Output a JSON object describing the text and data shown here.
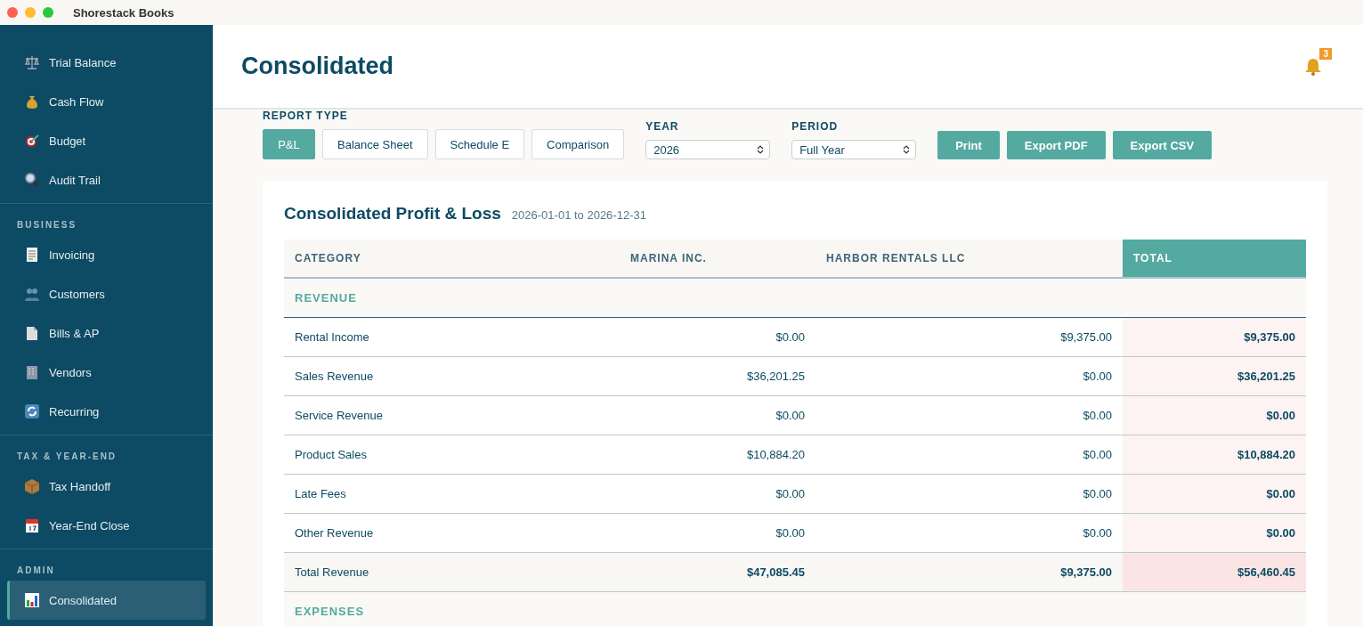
{
  "window": {
    "title": "Shorestack Books"
  },
  "sidebar": {
    "sections": [
      {
        "items": [
          {
            "label": "Trial Balance",
            "selected": false
          },
          {
            "label": "Cash Flow",
            "selected": false
          },
          {
            "label": "Budget",
            "selected": false
          },
          {
            "label": "Audit Trail",
            "selected": false
          }
        ]
      },
      {
        "label": "BUSINESS",
        "items": [
          {
            "label": "Invoicing",
            "selected": false
          },
          {
            "label": "Customers",
            "selected": false
          },
          {
            "label": "Bills & AP",
            "selected": false
          },
          {
            "label": "Vendors",
            "selected": false
          },
          {
            "label": "Recurring",
            "selected": false
          }
        ]
      },
      {
        "label": "TAX & YEAR-END",
        "items": [
          {
            "label": "Tax Handoff",
            "selected": false
          },
          {
            "label": "Year-End Close",
            "selected": false
          }
        ]
      },
      {
        "label": "ADMIN",
        "items": [
          {
            "label": "Consolidated",
            "selected": true
          }
        ]
      }
    ]
  },
  "header": {
    "title": "Consolidated",
    "notification_count": "3"
  },
  "controls": {
    "report_type": {
      "label": "REPORT TYPE",
      "options": [
        {
          "label": "P&L",
          "selected": true
        },
        {
          "label": "Balance Sheet",
          "selected": false
        },
        {
          "label": "Schedule E",
          "selected": false
        },
        {
          "label": "Comparison",
          "selected": false
        }
      ]
    },
    "year": {
      "label": "YEAR",
      "value": "2026"
    },
    "period": {
      "label": "PERIOD",
      "value": "Full Year"
    },
    "actions": [
      "Print",
      "Export PDF",
      "Export CSV"
    ]
  },
  "report": {
    "title": "Consolidated Profit & Loss",
    "date_range": "2026-01-01 to 2026-12-31",
    "columns": [
      {
        "label": "CATEGORY",
        "highlighted": false
      },
      {
        "label": "MARINA INC.",
        "highlighted": false
      },
      {
        "label": "HARBOR RENTALS LLC",
        "highlighted": false
      },
      {
        "label": "TOTAL",
        "highlighted": true
      }
    ],
    "rows": [
      {
        "kind": "section",
        "cells": [
          "REVENUE"
        ]
      },
      {
        "kind": "item",
        "cells": [
          "Rental Income",
          "$0.00",
          "$9,375.00",
          "$9,375.00"
        ]
      },
      {
        "kind": "item",
        "cells": [
          "Sales Revenue",
          "$36,201.25",
          "$0.00",
          "$36,201.25"
        ]
      },
      {
        "kind": "item",
        "cells": [
          "Service Revenue",
          "$0.00",
          "$0.00",
          "$0.00"
        ]
      },
      {
        "kind": "item",
        "cells": [
          "Product Sales",
          "$10,884.20",
          "$0.00",
          "$10,884.20"
        ]
      },
      {
        "kind": "item",
        "cells": [
          "Late Fees",
          "$0.00",
          "$0.00",
          "$0.00"
        ]
      },
      {
        "kind": "item",
        "cells": [
          "Other Revenue",
          "$0.00",
          "$0.00",
          "$0.00"
        ]
      },
      {
        "kind": "total",
        "cells": [
          "Total Revenue",
          "$47,085.45",
          "$9,375.00",
          "$56,460.45"
        ]
      },
      {
        "kind": "section",
        "cells": [
          "EXPENSES"
        ]
      }
    ]
  }
}
